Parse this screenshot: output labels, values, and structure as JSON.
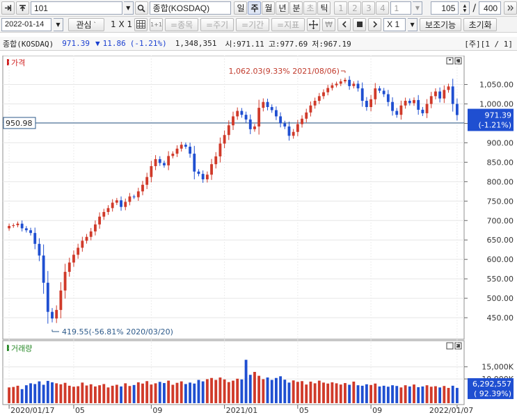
{
  "toolbar": {
    "code_value": "101",
    "name_value": "종합(KOSDAQ)",
    "periods": [
      "일",
      "주",
      "월",
      "년",
      "분",
      "초",
      "틱"
    ],
    "selected_period": "주",
    "minute_buttons": [
      "1",
      "2",
      "3",
      "4"
    ],
    "count_value": "1",
    "zoom_value": "105",
    "slash": "/",
    "total_value": "400"
  },
  "toolbar2": {
    "date_value": "2022-01-14",
    "interest_label": "관심",
    "layout_label": "1 X 1",
    "layout_small": "1+1",
    "item_label": "=종목",
    "period_label": "=주기",
    "range_label": "=기간",
    "indicator_label": "=지표",
    "multiplier_value": "X 1",
    "aux_label": "보조기능",
    "reset_label": "초기화"
  },
  "info": {
    "name": "종합(KOSDAQ)",
    "price": "971.39",
    "change_arrow": "▼",
    "change": "11.86",
    "change_pct": "(-1.21%)",
    "volume": "1,348,351",
    "open": "시:971.11",
    "high": "고:977.69",
    "low": "저:967.19",
    "page": "[주][1 / 1]"
  },
  "chart_data": {
    "type": "candlestick",
    "period": "weekly",
    "price_pane_label": "가격",
    "volume_pane_label": "거래량",
    "price_ticks": [
      450,
      500,
      550,
      600,
      650,
      700,
      750,
      800,
      850,
      900,
      950,
      1000,
      1050
    ],
    "price_tick_labels": [
      "450.00",
      "500.00",
      "550.00",
      "600.00",
      "650.00",
      "700.00",
      "750.00",
      "800.00",
      "850.00",
      "900.00",
      "950.00",
      "1,000.00",
      "1,050.00"
    ],
    "volume_ticks": [
      10000,
      15000
    ],
    "volume_tick_labels": [
      "10,000K",
      "15,000K"
    ],
    "x_labels": [
      "2020/01/17",
      "05",
      "09",
      "2021/01",
      "05",
      "09",
      "2022/01/07"
    ],
    "x_label_weeks": [
      0,
      15,
      33,
      50,
      67,
      84,
      104
    ],
    "reference_line": {
      "value": 950.98,
      "label": "950.98"
    },
    "current_price": {
      "value": 971.39,
      "label": "971.39",
      "pct": "(-1.21%)"
    },
    "current_volume": {
      "label": "6,292,557",
      "pct": "( 92.39%)"
    },
    "high_annotation": "1,062.03(9.33% 2021/08/06)",
    "low_annotation": "419.55(-56.81% 2020/03/20)",
    "closes": [
      686,
      688,
      692,
      680,
      675,
      668,
      640,
      610,
      540,
      465,
      448,
      470,
      520,
      568,
      592,
      612,
      630,
      648,
      658,
      672,
      690,
      710,
      722,
      732,
      746,
      752,
      735,
      748,
      762,
      760,
      775,
      792,
      812,
      840,
      858,
      848,
      842,
      866,
      872,
      885,
      895,
      890,
      872,
      826,
      820,
      806,
      818,
      845,
      865,
      898,
      920,
      945,
      968,
      982,
      972,
      960,
      935,
      942,
      990,
      1005,
      992,
      984,
      968,
      950,
      942,
      918,
      928,
      948,
      962,
      978,
      996,
      1008,
      1020,
      1030,
      1041,
      1048,
      1052,
      1058,
      1062,
      1046,
      1052,
      1040,
      1008,
      992,
      1012,
      1040,
      1034,
      1025,
      1005,
      982,
      972,
      996,
      1008,
      1002,
      1010,
      985,
      976,
      1000,
      1020,
      1032,
      1014,
      1036,
      1045,
      1000,
      971.39
    ],
    "volumes_k": [
      6500,
      6700,
      7200,
      5800,
      7400,
      8200,
      7900,
      9000,
      7600,
      9200,
      8600,
      8200,
      7800,
      8400,
      7200,
      6800,
      7000,
      8500,
      7300,
      7800,
      6900,
      7400,
      7900,
      6500,
      7200,
      7600,
      6900,
      8200,
      7100,
      7500,
      8600,
      8100,
      9100,
      7700,
      8200,
      8800,
      8300,
      9300,
      7600,
      8400,
      9000,
      7900,
      8500,
      8100,
      9600,
      9000,
      9900,
      10400,
      9600,
      10600,
      9800,
      8700,
      9300,
      10100,
      9800,
      17900,
      11700,
      12900,
      11300,
      9900,
      10600,
      9600,
      10400,
      11100,
      9700,
      8500,
      9400,
      8800,
      9100,
      7700,
      8900,
      8200,
      9300,
      8500,
      8100,
      8600,
      8200,
      7700,
      8300,
      7600,
      8900,
      7400,
      7200,
      7800,
      7500,
      8100,
      6900,
      7200,
      6800,
      7400,
      7100,
      6500,
      7400,
      6900,
      7700,
      6600,
      6900,
      7400,
      6800,
      7000,
      6500,
      7100,
      6300,
      7200,
      6292.557
    ]
  }
}
